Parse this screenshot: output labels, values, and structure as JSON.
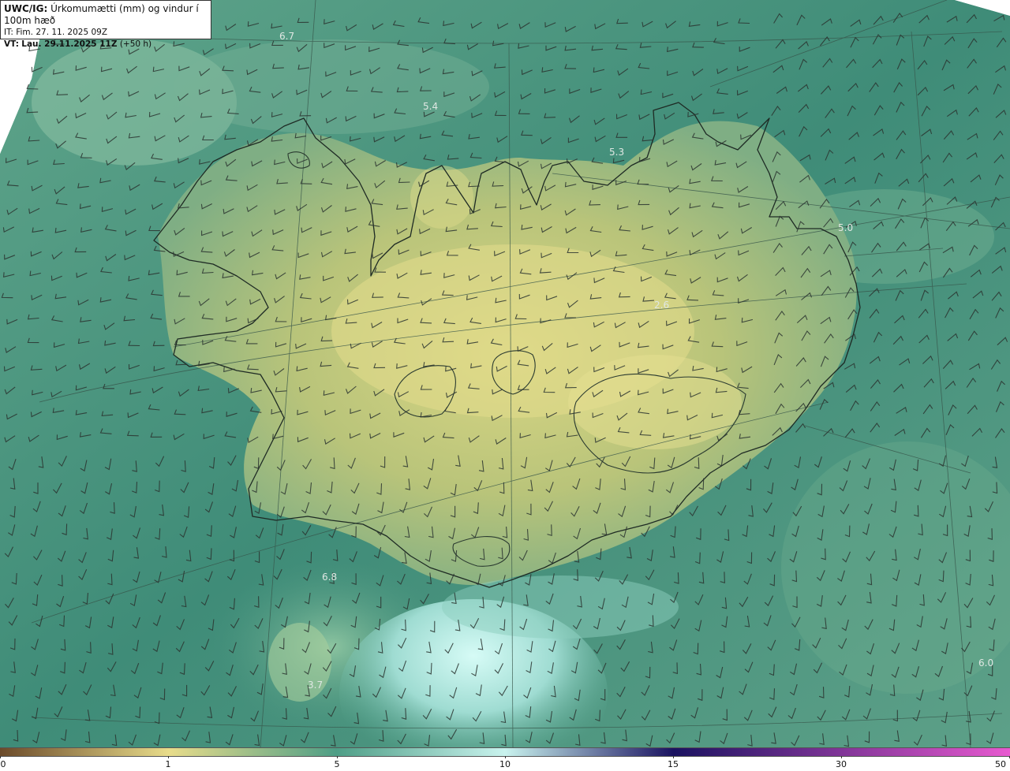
{
  "header": {
    "model": "UWC/IG:",
    "title": "Úrkomumætti (mm) og vindur í 100m hæð",
    "init_line": "IT: Fim. 27. 11. 2025 09Z",
    "valid_prefix": "VT:",
    "valid_bold": "Lau. 29.11.2025 11Z",
    "valid_suffix": "(+50 h)"
  },
  "map_labels": [
    {
      "name": "label-6-7",
      "text": "6.7"
    },
    {
      "name": "label-5-4",
      "text": "5.4"
    },
    {
      "name": "label-5-3",
      "text": "5.3"
    },
    {
      "name": "label-5-0",
      "text": "5.0"
    },
    {
      "name": "label-2-6",
      "text": "2.6"
    },
    {
      "name": "label-6-8",
      "text": "6.8"
    },
    {
      "name": "label-3-7",
      "text": "3.7"
    },
    {
      "name": "label-6-0",
      "text": "6.0"
    }
  ],
  "colorbar": {
    "ticks": [
      "0",
      "1",
      "5",
      "10",
      "15",
      "30",
      "50"
    ],
    "colors": {
      "dry": "#6b4a2a",
      "low": "#e8dc8a",
      "mid": "#4e9e86",
      "high": "#c9f3ee",
      "very_high": "#1a1260",
      "extreme": "#e85ad0"
    }
  }
}
